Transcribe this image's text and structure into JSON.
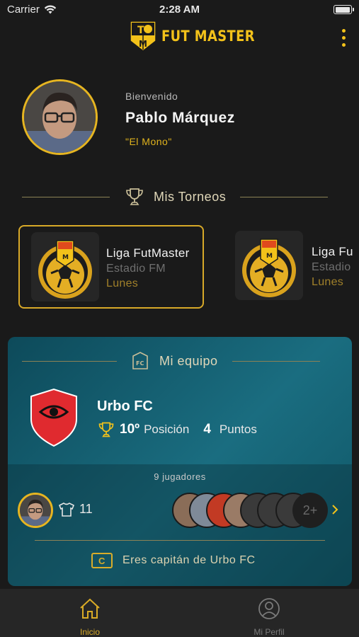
{
  "status_bar": {
    "carrier": "Carrier",
    "time": "2:28 AM",
    "battery_level": 1.0
  },
  "header": {
    "brand": "FUT MASTER",
    "menu_icon": "more-vertical-icon"
  },
  "profile": {
    "welcome": "Bienvenido",
    "name": "Pablo Márquez",
    "nickname": "\"El Mono\""
  },
  "tournaments_section": {
    "title": "Mis Torneos",
    "icon": "trophy-icon"
  },
  "tournaments": [
    {
      "name": "Liga FutMaster",
      "venue": "Estadio FM",
      "day": "Lunes"
    },
    {
      "name": "Liga Fu",
      "venue": "Estadio",
      "day": "Lunes"
    }
  ],
  "team_section": {
    "title": "Mi equipo",
    "icon": "fc-badge-icon"
  },
  "team": {
    "name": "Urbo FC",
    "position": "10º",
    "position_label": "Posición",
    "points": "4",
    "points_label": "Puntos",
    "players_count": "9 jugadores",
    "shirt_number": "11",
    "more_players": "2+",
    "captain_badge": "C",
    "captain_text": "Eres capitán de Urbo FC"
  },
  "colors": {
    "accent": "#F3C21A",
    "background": "#1A1A1A",
    "team_card": "#1A6D80",
    "crest_red": "#E02A2F"
  },
  "tabs": [
    {
      "label": "Inicio",
      "icon": "home-icon",
      "active": true
    },
    {
      "label": "Mi Perfil",
      "icon": "user-circle-icon",
      "active": false
    }
  ]
}
